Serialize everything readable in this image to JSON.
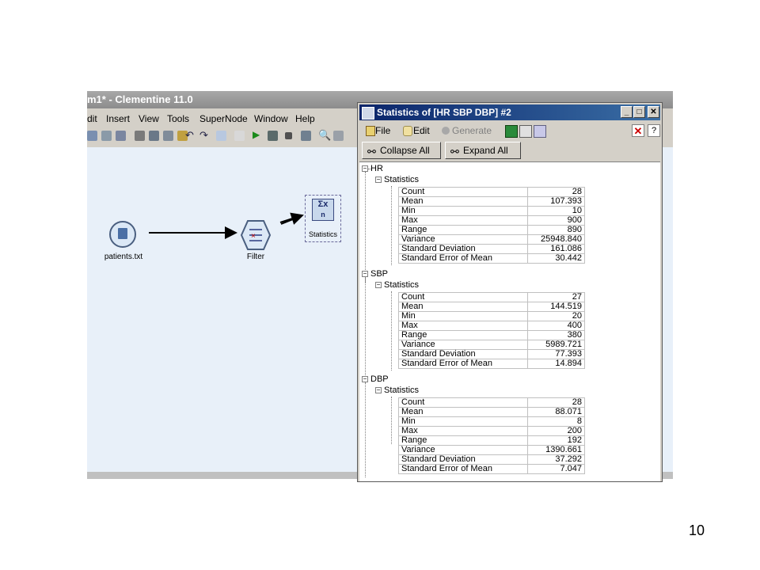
{
  "app": {
    "title": "m1* - Clementine 11.0",
    "menu": [
      "dit",
      "Insert",
      "View",
      "Tools",
      "SuperNode",
      "Window",
      "Help"
    ]
  },
  "canvas": {
    "nodes": [
      {
        "label": "patients.txt"
      },
      {
        "label": "Filter"
      },
      {
        "label": "Statistics",
        "icon_text": "Σx"
      }
    ]
  },
  "dialog": {
    "title": "Statistics of [HR SBP DBP] #2",
    "menu": {
      "file": "File",
      "edit": "Edit",
      "generate": "Generate"
    },
    "buttons": {
      "collapse_all": "Collapse All",
      "expand_all": "Expand All"
    },
    "fields": [
      {
        "name": "HR",
        "group_label": "Statistics",
        "stats": [
          {
            "label": "Count",
            "value": "28"
          },
          {
            "label": "Mean",
            "value": "107.393"
          },
          {
            "label": "Min",
            "value": "10"
          },
          {
            "label": "Max",
            "value": "900"
          },
          {
            "label": "Range",
            "value": "890"
          },
          {
            "label": "Variance",
            "value": "25948.840"
          },
          {
            "label": "Standard Deviation",
            "value": "161.086"
          },
          {
            "label": "Standard Error of Mean",
            "value": "30.442"
          }
        ]
      },
      {
        "name": "SBP",
        "group_label": "Statistics",
        "stats": [
          {
            "label": "Count",
            "value": "27"
          },
          {
            "label": "Mean",
            "value": "144.519"
          },
          {
            "label": "Min",
            "value": "20"
          },
          {
            "label": "Max",
            "value": "400"
          },
          {
            "label": "Range",
            "value": "380"
          },
          {
            "label": "Variance",
            "value": "5989.721"
          },
          {
            "label": "Standard Deviation",
            "value": "77.393"
          },
          {
            "label": "Standard Error of Mean",
            "value": "14.894"
          }
        ]
      },
      {
        "name": "DBP",
        "group_label": "Statistics",
        "stats": [
          {
            "label": "Count",
            "value": "28"
          },
          {
            "label": "Mean",
            "value": "88.071"
          },
          {
            "label": "Min",
            "value": "8"
          },
          {
            "label": "Max",
            "value": "200"
          },
          {
            "label": "Range",
            "value": "192"
          },
          {
            "label": "Variance",
            "value": "1390.661"
          },
          {
            "label": "Standard Deviation",
            "value": "37.292"
          },
          {
            "label": "Standard Error of Mean",
            "value": "7.047"
          }
        ]
      }
    ]
  },
  "page_number": "10",
  "colors": {
    "canvas_bg": "#e8f0f9",
    "titlebar_active": "#0a246a",
    "close_red": "#cc0000"
  }
}
